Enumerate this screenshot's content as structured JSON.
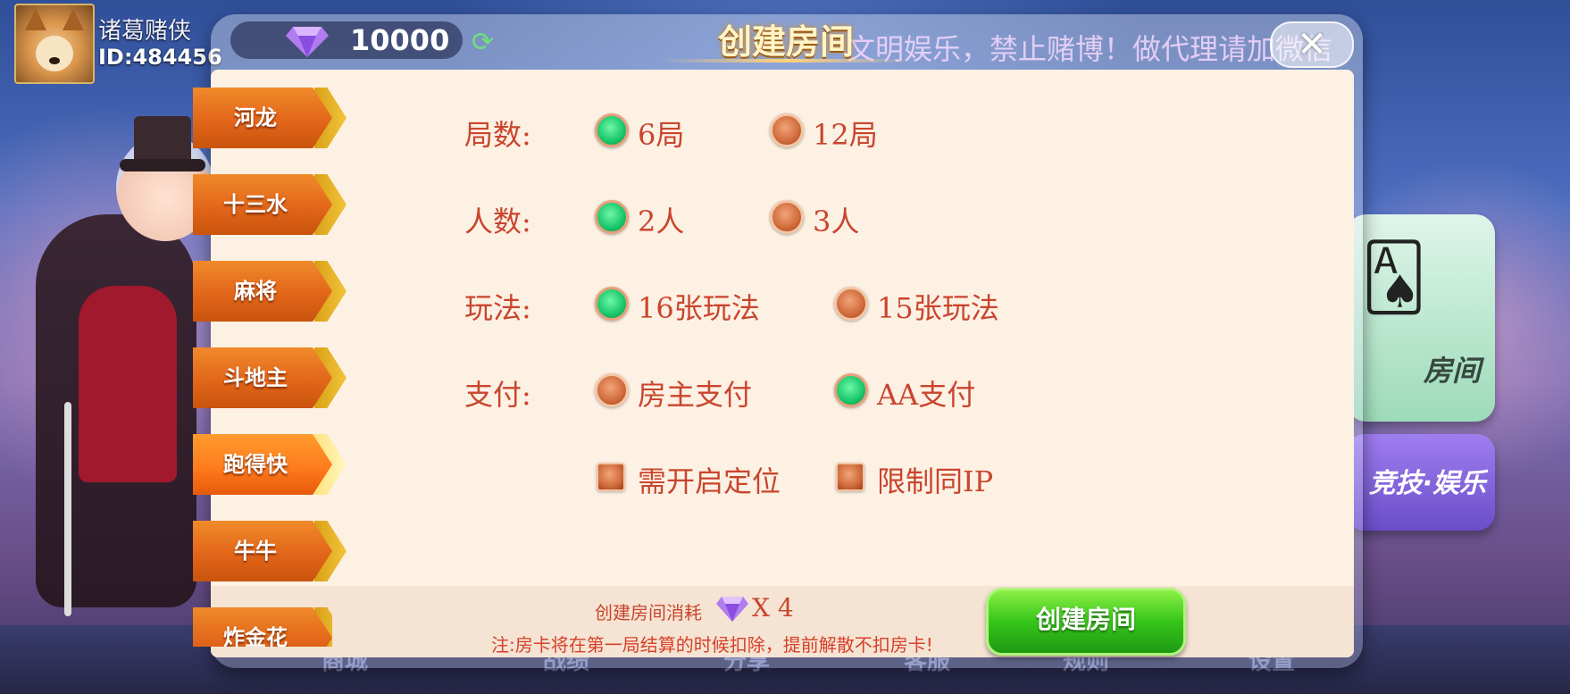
{
  "player": {
    "name": "诸葛赌侠",
    "id": "ID:484456"
  },
  "top_bar": {
    "diamonds": "10000",
    "marquee": "文明娱乐，禁止赌博！做代理请加微信"
  },
  "background": {
    "card_room_label": "房间",
    "card_purple_label": "竞技·娱乐",
    "bottom_nav": [
      "商城",
      "战绩",
      "分享",
      "客服",
      "规则",
      "设置"
    ]
  },
  "dialog": {
    "title": "创建房间",
    "close_icon": "close-icon",
    "tabs": [
      {
        "label": "河龙",
        "active": false
      },
      {
        "label": "十三水",
        "active": false
      },
      {
        "label": "麻将",
        "active": false
      },
      {
        "label": "斗地主",
        "active": false
      },
      {
        "label": "跑得快",
        "active": true
      },
      {
        "label": "牛牛",
        "active": false
      },
      {
        "label": "炸金花",
        "active": false
      }
    ],
    "options": [
      {
        "label": "局数:",
        "choices": [
          {
            "text": "6局",
            "selected": true
          },
          {
            "text": "12局",
            "selected": false
          }
        ]
      },
      {
        "label": "人数:",
        "choices": [
          {
            "text": "2人",
            "selected": true
          },
          {
            "text": "3人",
            "selected": false
          }
        ]
      },
      {
        "label": "玩法:",
        "choices": [
          {
            "text": "16张玩法",
            "selected": true
          },
          {
            "text": "15张玩法",
            "selected": false
          }
        ]
      },
      {
        "label": "支付:",
        "choices": [
          {
            "text": "房主支付",
            "selected": false
          },
          {
            "text": "AA支付",
            "selected": true
          }
        ]
      }
    ],
    "checkboxes": [
      {
        "text": "需开启定位",
        "checked": false
      },
      {
        "text": "限制同IP",
        "checked": false
      }
    ],
    "cost_label": "创建房间消耗",
    "cost_multiplier": "X 4",
    "notice": "注:房卡将在第一局结算的时候扣除，提前解散不扣房卡!",
    "create_button": "创建房间"
  },
  "colors": {
    "selected": "#18c66a",
    "unselected": "#cf6a3b",
    "text": "#c9452d",
    "tab": "#e2661a",
    "button": "#36c51a"
  }
}
